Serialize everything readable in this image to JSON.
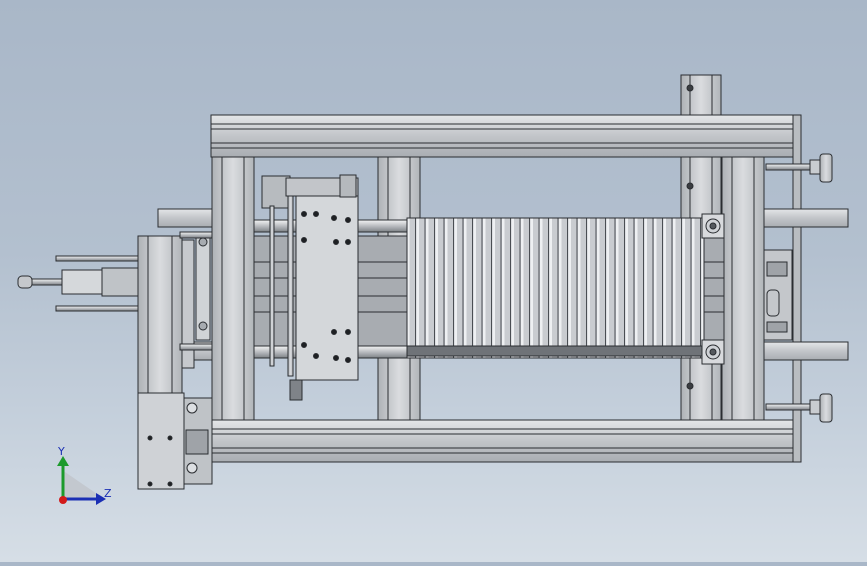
{
  "viewport": {
    "background_top": "#a9b7c8",
    "background_bottom": "#d6dee6",
    "part_color": "#cfd2d6",
    "edge_color": "#2a2d31"
  },
  "triad": {
    "y_label": "Y",
    "z_label": "Z",
    "y_axis_color": "#1c9a2c",
    "z_axis_color": "#1b2fb4",
    "x_axis_color": "#d21a1a"
  }
}
